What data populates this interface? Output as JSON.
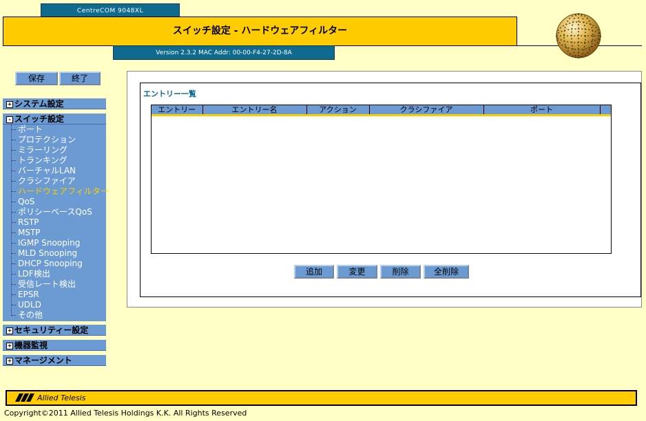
{
  "header": {
    "model": "CentreCOM 9048XL",
    "title": "スイッチ設定 - ハードウェアフィルター",
    "version_info": "Version 2.3.2 MAC Addr: 00-00-F4-27-2D-8A"
  },
  "toolbar": {
    "save_label": "保存",
    "exit_label": "終了"
  },
  "sidebar": {
    "sections": {
      "system": {
        "expander": "+",
        "label": "システム設定"
      },
      "switch": {
        "expander": "-",
        "label": "スイッチ設定"
      },
      "security": {
        "expander": "+",
        "label": "セキュリティー設定"
      },
      "monitor": {
        "expander": "+",
        "label": "機器監視"
      },
      "management": {
        "expander": "+",
        "label": "マネージメント"
      }
    },
    "switch_items": [
      "ポート",
      "プロテクション",
      "ミラーリング",
      "トランキング",
      "バーチャルLAN",
      "クラシファイア",
      "ハードウェアフィルター",
      "QoS",
      "ポリシーベースQoS",
      "RSTP",
      "MSTP",
      "IGMP Snooping",
      "MLD Snooping",
      "DHCP Snooping",
      "LDF検出",
      "受信レート検出",
      "EPSR",
      "UDLD",
      "その他"
    ],
    "active_item": "ハードウェアフィルター"
  },
  "main": {
    "section_title": "エントリー一覧",
    "columns": [
      "エントリー",
      "エントリー名",
      "アクション",
      "クラシファイア",
      "ポート",
      ""
    ],
    "rows": [],
    "buttons": {
      "add": "追加",
      "edit": "変更",
      "delete": "削除",
      "delete_all": "全削除"
    }
  },
  "footer": {
    "brand": "Allied Telesis",
    "copyright": "Copyright©2011 Allied Telesis Holdings K.K. All Rights Reserved"
  },
  "colors": {
    "background": "#FFFFC6",
    "accent_yellow": "#FFCC00",
    "header_teal": "#0F6A8E",
    "menu_blue": "#6B9BD2",
    "active_text": "#FFCC00"
  }
}
